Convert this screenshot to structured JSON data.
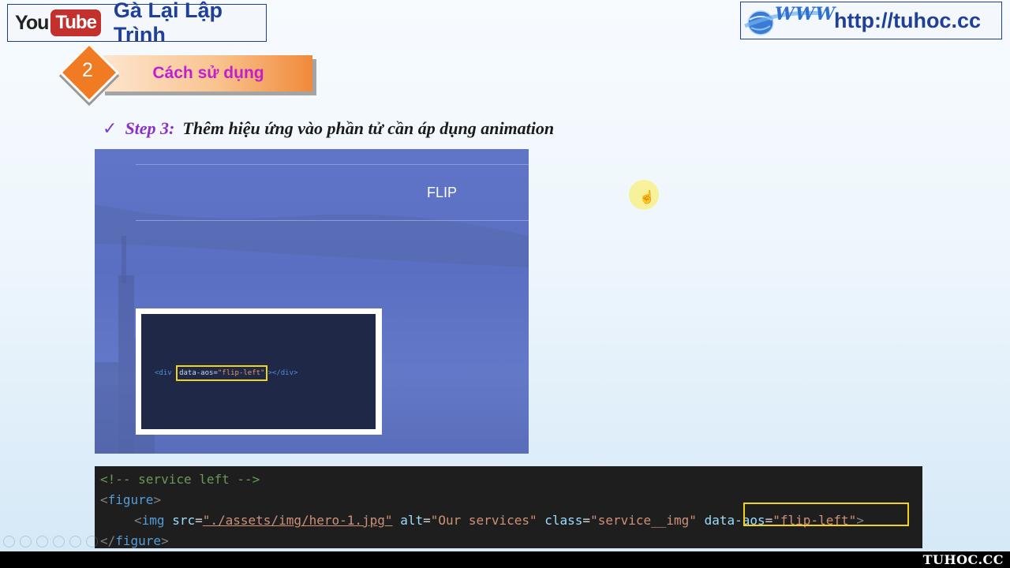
{
  "header": {
    "youtube_you": "You",
    "youtube_tube": "Tube",
    "channel_name": "Gà Lại Lập Trình",
    "www_label": "WWW",
    "url": "http://tuhoc.cc"
  },
  "section": {
    "number": "2",
    "title": "Cách sử dụng"
  },
  "step": {
    "check": "✓",
    "label": "Step 3:",
    "description": "Thêm hiệu ứng vào phần tử cần áp dụng animation"
  },
  "demo": {
    "title": "FLIP",
    "code_open": "<div ",
    "code_attr": "data-aos=",
    "code_value": "\"flip-left\"",
    "code_close": "></div>"
  },
  "code": {
    "line1": "<!-- service left -->",
    "line2_lt": "<",
    "line2_tag": "figure",
    "line2_gt": ">",
    "line3_lt": "<",
    "line3_tag": "img",
    "line3_src_attr": "src",
    "line3_src_val": "\"./assets/img/hero-1.jpg\"",
    "line3_alt_attr": "alt",
    "line3_alt_val": "\"Our services\"",
    "line3_class_attr": "class",
    "line3_class_val": "\"service__img\"",
    "line3_aos_attr": "data-aos",
    "line3_aos_val": "\"flip-left\"",
    "line3_gt": ">",
    "line4_lt": "</",
    "line4_tag": "figure",
    "line4_gt": ">"
  },
  "footer": {
    "watermark": "TUHOC.CC"
  },
  "colors": {
    "accent_orange": "#f07b22",
    "brand_blue": "#1f3f99",
    "highlight_yellow": "#f1d21d",
    "step_purple": "#8a2fc8"
  }
}
